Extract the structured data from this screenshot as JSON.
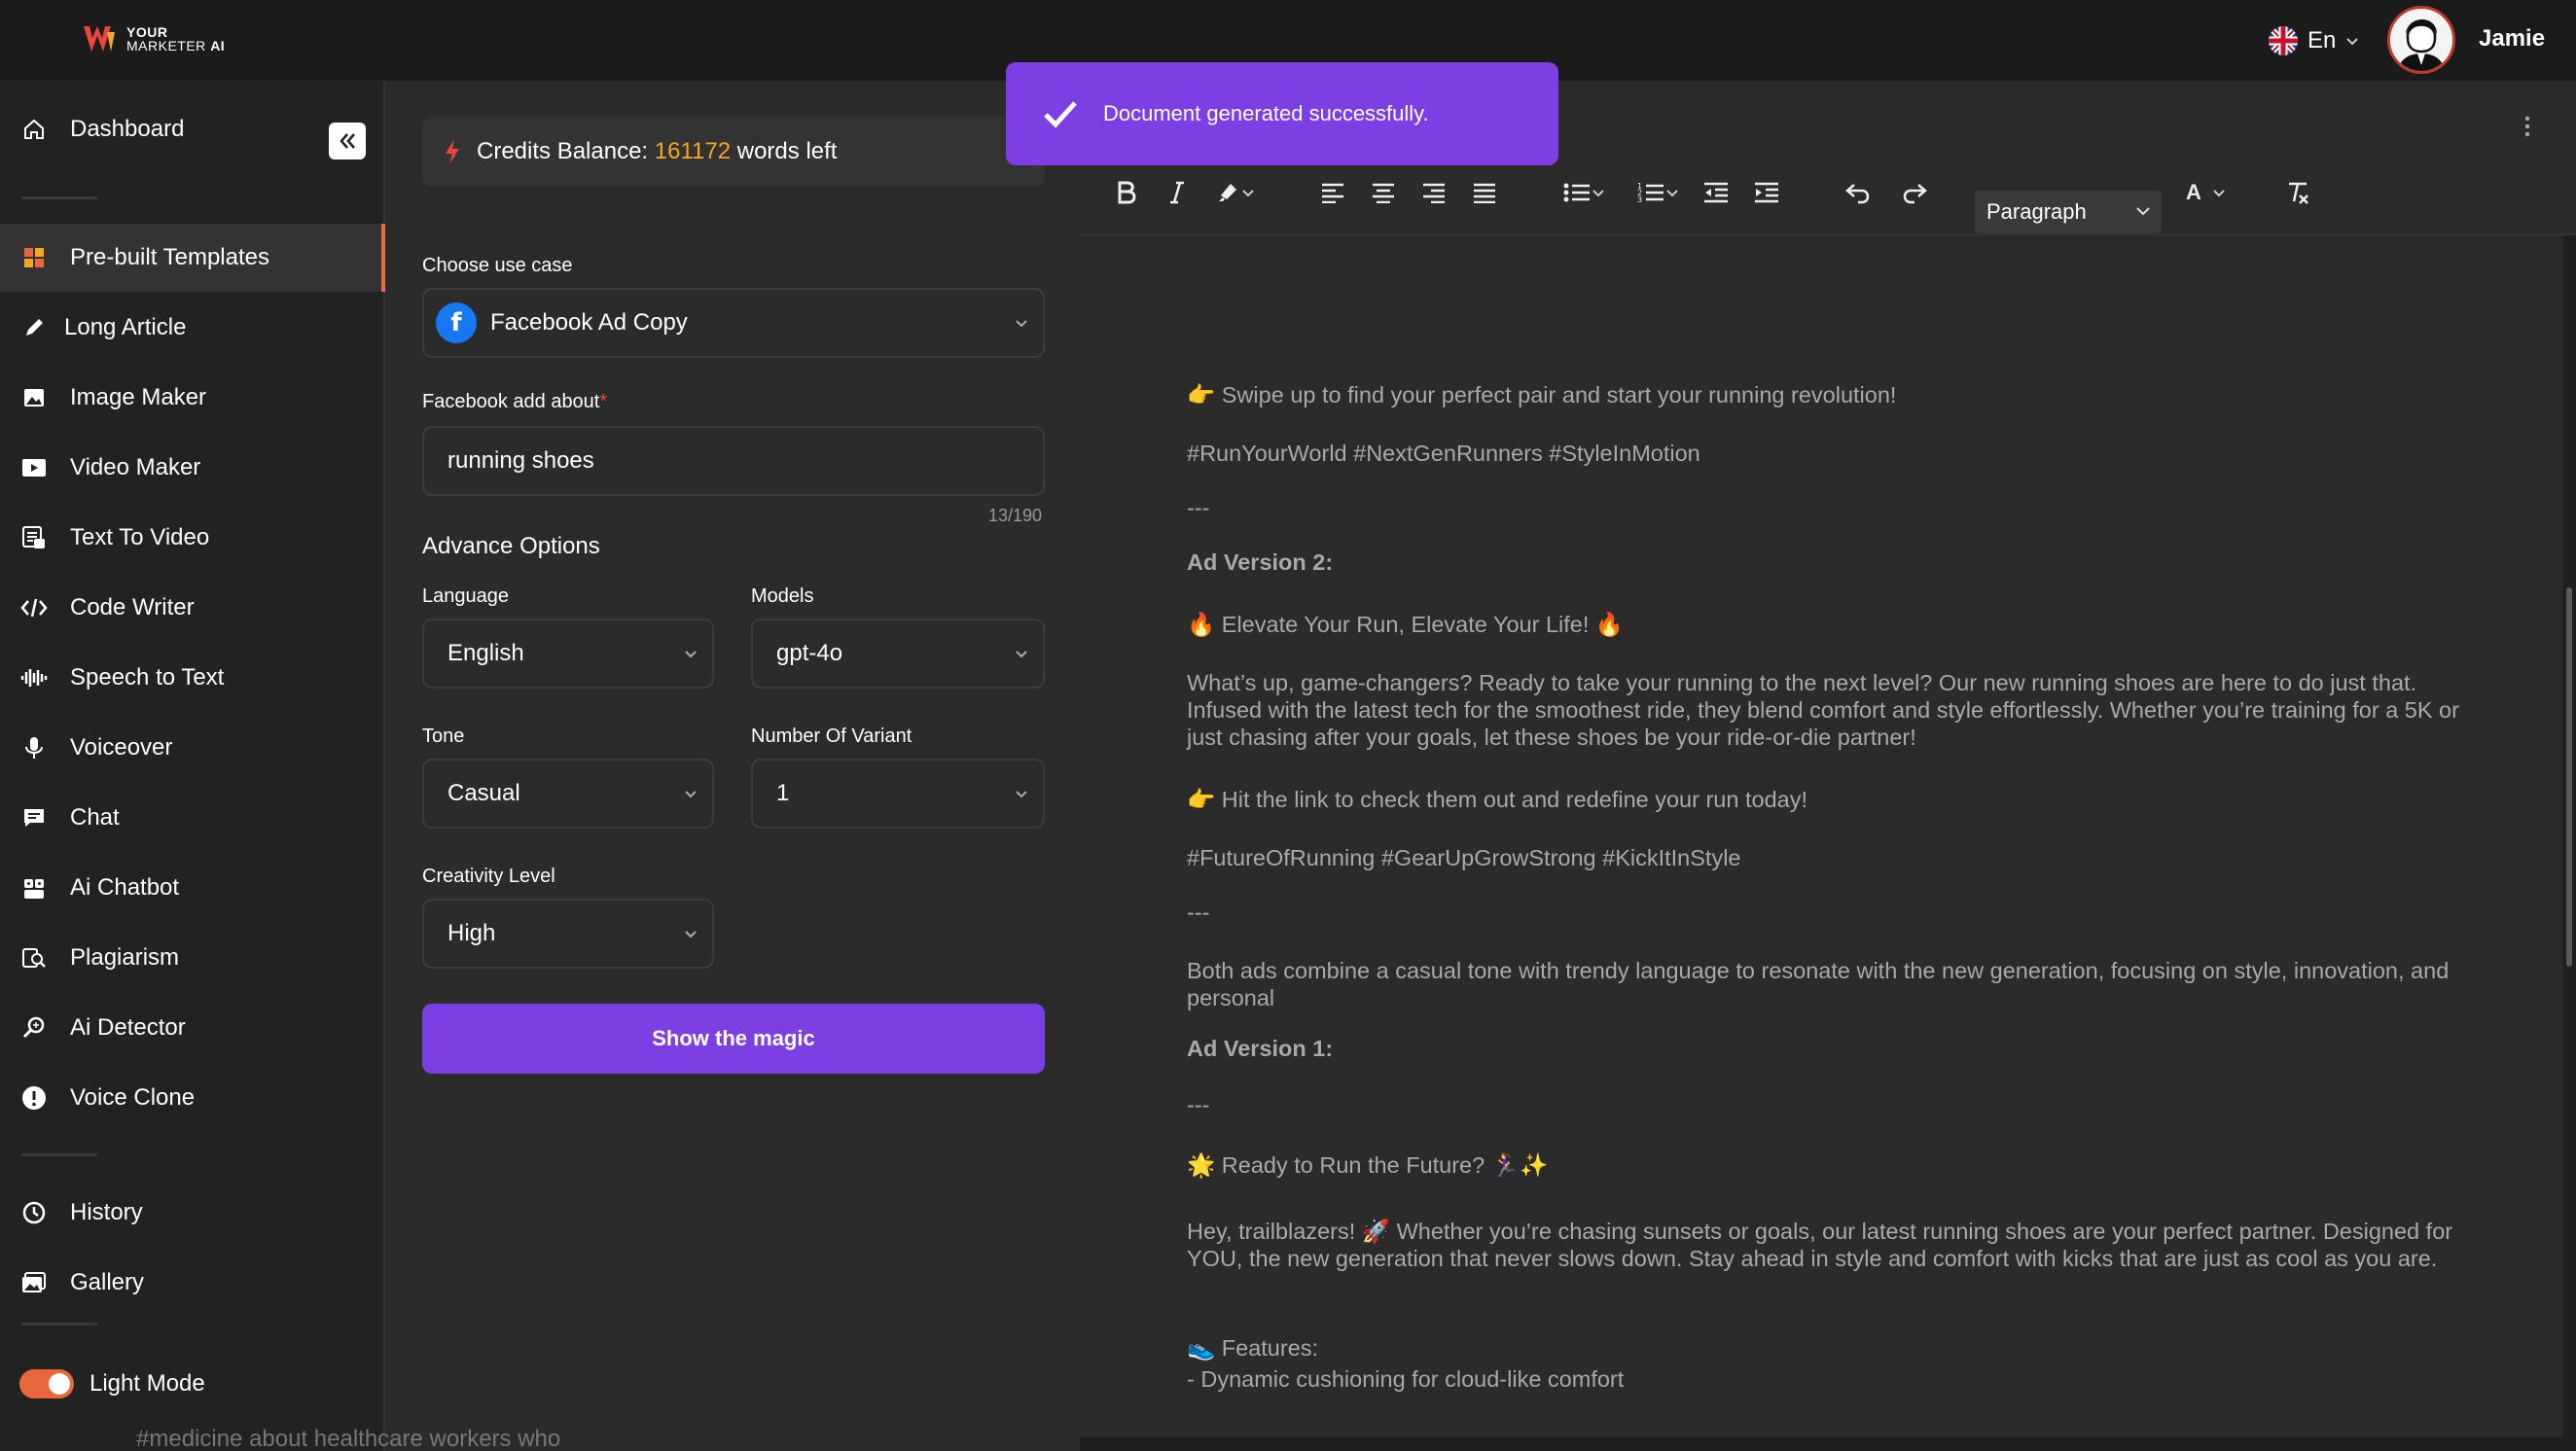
{
  "brand": {
    "line1": "YOUR",
    "line2a": "MARKETER",
    "line2b": "AI"
  },
  "header": {
    "language": "En",
    "user_name": "Jamie"
  },
  "sidebar": {
    "items": [
      {
        "label": "Dashboard",
        "icon": "home-icon"
      },
      {
        "label": "Pre-built Templates",
        "icon": "templates-icon",
        "active": true
      },
      {
        "label": "Long Article",
        "icon": "pen-icon"
      },
      {
        "label": "Image Maker",
        "icon": "image-icon"
      },
      {
        "label": "Video Maker",
        "icon": "video-icon"
      },
      {
        "label": "Text To Video",
        "icon": "text-video-icon"
      },
      {
        "label": "Code Writer",
        "icon": "code-icon"
      },
      {
        "label": "Speech to Text",
        "icon": "waveform-icon"
      },
      {
        "label": "Voiceover",
        "icon": "microphone-icon"
      },
      {
        "label": "Chat",
        "icon": "chat-icon"
      },
      {
        "label": "Ai Chatbot",
        "icon": "bot-icon"
      },
      {
        "label": "Plagiarism",
        "icon": "plagiarism-icon"
      },
      {
        "label": "Ai Detector",
        "icon": "detector-icon"
      },
      {
        "label": "Voice Clone",
        "icon": "alert-icon"
      },
      {
        "label": "History",
        "icon": "history-icon"
      },
      {
        "label": "Gallery",
        "icon": "gallery-icon"
      }
    ],
    "light_mode_label": "Light Mode"
  },
  "form": {
    "credits_label": "Credits Balance:",
    "credits_value": "161172",
    "credits_suffix": "words left",
    "use_case_label": "Choose use case",
    "use_case_value": "Facebook Ad Copy",
    "about_label": "Facebook add about",
    "about_required": "*",
    "about_value": "running shoes",
    "about_counter": "13/190",
    "advance_title": "Advance Options",
    "language_label": "Language",
    "language_value": "English",
    "models_label": "Models",
    "models_value": "gpt-4o",
    "tone_label": "Tone",
    "tone_value": "Casual",
    "variants_label": "Number Of Variant",
    "variants_value": "1",
    "creativity_label": "Creativity Level",
    "creativity_value": "High",
    "submit_label": "Show the magic"
  },
  "editor": {
    "paragraph_select": "Paragraph",
    "font_color_label": "A",
    "lines": [
      "👉 Swipe up to find your perfect pair and start your running revolution!",
      "#RunYourWorld #NextGenRunners #StyleInMotion",
      "---",
      "Ad Version 2:",
      "🔥 Elevate Your Run, Elevate Your Life! 🔥",
      "What’s up, game-changers? Ready to take your running to the next level? Our new running shoes are here to do just that. Infused with the latest tech for the smoothest ride, they blend comfort and style effortlessly. Whether you’re training for a 5K or just chasing after your goals, let these shoes be your ride-or-die partner!",
      "👉 Hit the link to check them out and redefine your run today!",
      "#FutureOfRunning #GearUpGrowStrong #KickItInStyle",
      "---",
      "Both ads combine a casual tone with trendy language to resonate with the new generation, focusing on style, innovation, and personal",
      "Ad Version 1:",
      "---",
      "🌟 Ready to Run the Future? 🏃‍♀️✨",
      "Hey, trailblazers! 🚀 Whether you’re chasing sunsets or goals, our latest running shoes are your perfect partner. Designed for YOU, the new generation that never slows down. Stay ahead in style and comfort with kicks that are just as cool as you are.",
      "👟 Features:",
      "- Dynamic cushioning for cloud-like comfort"
    ],
    "cut_text": "#medicine about healthcare workers who"
  },
  "toast": {
    "message": "Document generated successfully."
  }
}
